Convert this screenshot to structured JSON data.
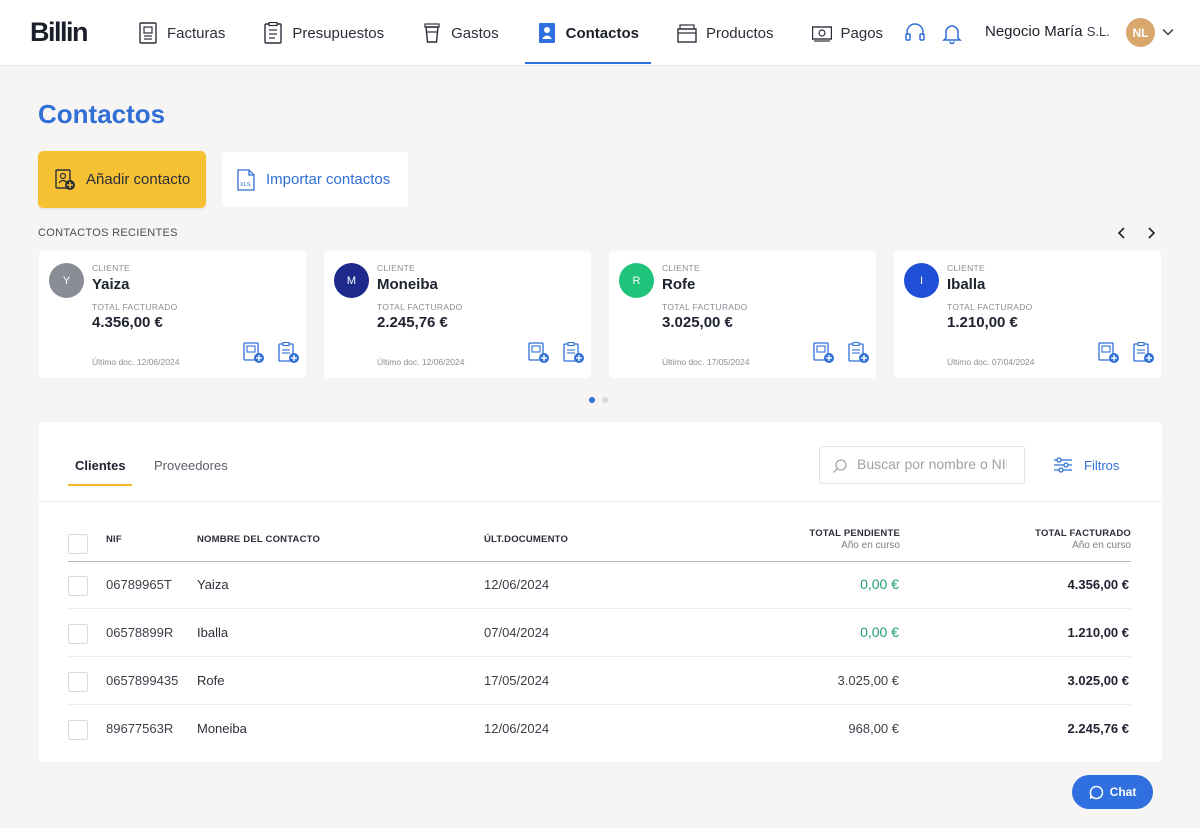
{
  "header": {
    "logo": "Billin",
    "nav": [
      {
        "label": "Facturas",
        "icon": "invoice-icon"
      },
      {
        "label": "Presupuestos",
        "icon": "quote-icon"
      },
      {
        "label": "Gastos",
        "icon": "cup-icon"
      },
      {
        "label": "Contactos",
        "icon": "contacts-icon",
        "active": true
      },
      {
        "label": "Productos",
        "icon": "box-icon"
      },
      {
        "label": "Pagos",
        "icon": "money-icon"
      }
    ],
    "company": "Negocio María",
    "company_suffix": "S.L.",
    "avatar_initials": "NL"
  },
  "page": {
    "title": "Contactos",
    "add_contact": "Añadir contacto",
    "import_contacts": "Importar contactos",
    "recent_title": "CONTACTOS RECIENTES"
  },
  "recent": [
    {
      "initial": "Y",
      "type": "CLIENTE",
      "name": "Yaiza",
      "billed_label": "TOTAL FACTURADO",
      "amount": "4.356,00 €",
      "last_doc": "Último doc. 12/06/2024",
      "color": "#8a8c96"
    },
    {
      "initial": "M",
      "type": "CLIENTE",
      "name": "Moneiba",
      "billed_label": "TOTAL FACTURADO",
      "amount": "2.245,76 €",
      "last_doc": "Último doc. 12/06/2024",
      "color": "#1d2a8c"
    },
    {
      "initial": "R",
      "type": "CLIENTE",
      "name": "Rofe",
      "billed_label": "TOTAL FACTURADO",
      "amount": "3.025,00 €",
      "last_doc": "Último doc. 17/05/2024",
      "color": "#1fc47a"
    },
    {
      "initial": "I",
      "type": "CLIENTE",
      "name": "Iballa",
      "billed_label": "TOTAL FACTURADO",
      "amount": "1.210,00 €",
      "last_doc": "Último doc. 07/04/2024",
      "color": "#1f4fd6"
    }
  ],
  "tabs": {
    "clients": "Clientes",
    "providers": "Proveedores"
  },
  "search": {
    "placeholder": "Buscar por nombre o NIF"
  },
  "filters": "Filtros",
  "table": {
    "headers": {
      "nif": "NIF",
      "name": "NOMBRE DEL CONTACTO",
      "last_doc": "ÚLT.DOCUMENTO",
      "pending": "TOTAL PENDIENTE",
      "pending_sub": "Año en curso",
      "billed": "TOTAL FACTURADO",
      "billed_sub": "Año en curso"
    },
    "rows": [
      {
        "nif": "06789965T",
        "name": "Yaiza",
        "last_doc": "12/06/2024",
        "pending": "0,00 €",
        "pending_zero": true,
        "billed": "4.356,00 €"
      },
      {
        "nif": "06578899R",
        "name": "Iballa",
        "last_doc": "07/04/2024",
        "pending": "0,00 €",
        "pending_zero": true,
        "billed": "1.210,00 €"
      },
      {
        "nif": "0657899435",
        "name": "Rofe",
        "last_doc": "17/05/2024",
        "pending": "3.025,00 €",
        "pending_zero": false,
        "billed": "3.025,00 €"
      },
      {
        "nif": "89677563R",
        "name": "Moneiba",
        "last_doc": "12/06/2024",
        "pending": "968,00 €",
        "pending_zero": false,
        "billed": "2.245,76 €"
      }
    ]
  },
  "chat": "Chat",
  "colors": {
    "accent": "#2f6fd6",
    "yellow": "#f6c133",
    "green": "#22a06b"
  }
}
